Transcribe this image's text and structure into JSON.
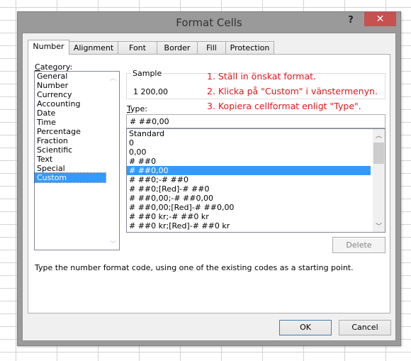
{
  "dialog": {
    "title": "Format Cells",
    "help_label": "?",
    "close_label": "✕"
  },
  "tabs": [
    {
      "label": "Number",
      "active": true
    },
    {
      "label": "Alignment",
      "active": false
    },
    {
      "label": "Font",
      "active": false
    },
    {
      "label": "Border",
      "active": false
    },
    {
      "label": "Fill",
      "active": false
    },
    {
      "label": "Protection",
      "active": false
    }
  ],
  "category": {
    "label_accel": "C",
    "label_rest": "ategory:",
    "items": [
      "General",
      "Number",
      "Currency",
      "Accounting",
      "Date",
      "Time",
      "Percentage",
      "Fraction",
      "Scientific",
      "Text",
      "Special",
      "Custom"
    ],
    "selected": "Custom"
  },
  "sample": {
    "label": "Sample",
    "value": "1 200,00"
  },
  "instructions": [
    "1. Ställ in önskat format.",
    "2. Klicka på \"Custom\" i vänstermenyn.",
    "3. Kopiera cellformat enligt \"Type\"."
  ],
  "instructions_color": "#e8151b",
  "type": {
    "label_accel": "T",
    "label_rest": "ype:",
    "value": "# ##0,00"
  },
  "formats": {
    "items": [
      "Standard",
      "0",
      "0,00",
      "# ##0",
      "# ##0,00",
      "# ##0;-# ##0",
      "# ##0;[Red]-# ##0",
      "# ##0,00;-# ##0,00",
      "# ##0,00;[Red]-# ##0,00",
      "# ##0 kr;-# ##0 kr",
      "# ##0 kr;[Red]-# ##0 kr"
    ],
    "selected": "# ##0,00"
  },
  "buttons": {
    "delete": "Delete",
    "ok": "OK",
    "cancel": "Cancel"
  },
  "description": "Type the number format code, using one of the existing codes as a starting point.",
  "colors": {
    "selection": "#3399ff",
    "close_button": "#c75050"
  }
}
